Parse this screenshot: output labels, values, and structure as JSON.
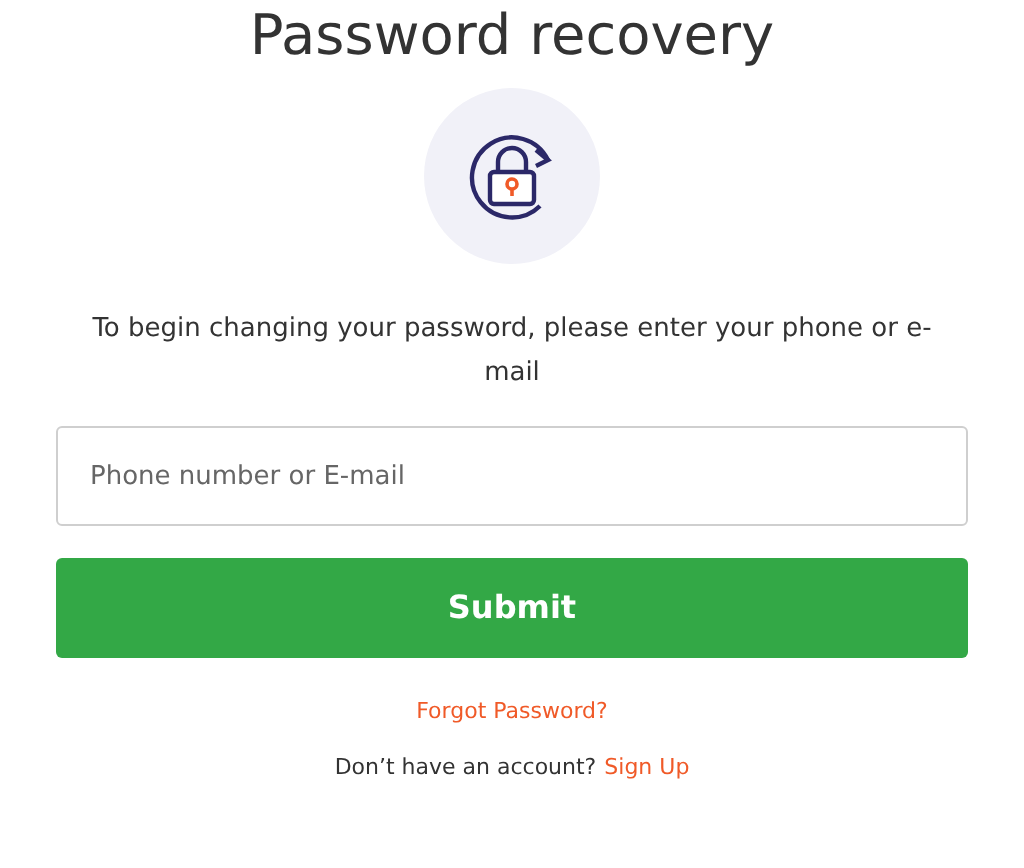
{
  "title": "Password recovery",
  "instructions": "To begin changing your password, please enter your phone or e-mail",
  "contact_field": {
    "placeholder": "Phone number or E-mail"
  },
  "submit_button": "Submit",
  "forgot_link": "Forgot Password?",
  "signup_prompt": {
    "text": "Don’t have an account?",
    "link": "Sign Up"
  }
}
